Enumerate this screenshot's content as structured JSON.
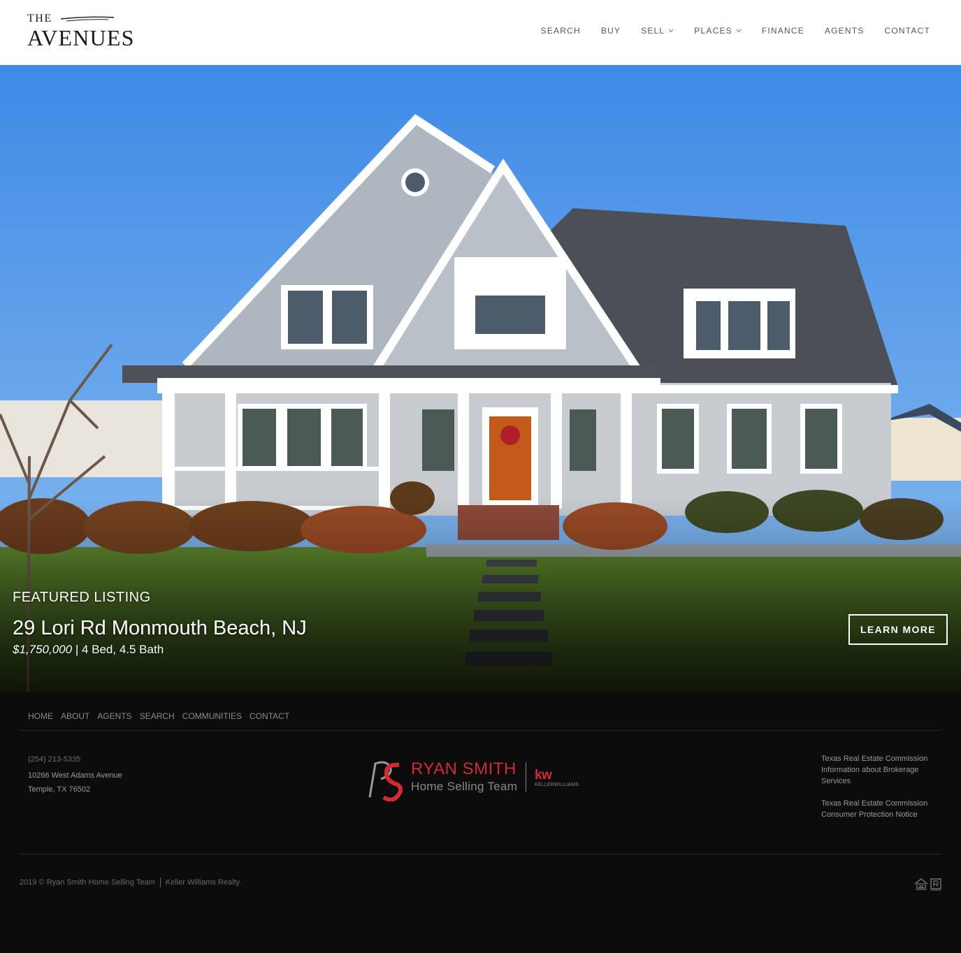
{
  "header": {
    "logo_top": "THE",
    "logo_main": "AVENUES",
    "nav": [
      {
        "label": "SEARCH",
        "dropdown": false
      },
      {
        "label": "BUY",
        "dropdown": false
      },
      {
        "label": "SELL",
        "dropdown": true
      },
      {
        "label": "PLACES",
        "dropdown": true
      },
      {
        "label": "FINANCE",
        "dropdown": false
      },
      {
        "label": "AGENTS",
        "dropdown": false
      },
      {
        "label": "CONTACT",
        "dropdown": false
      }
    ]
  },
  "hero": {
    "featured_label": "FEATURED LISTING",
    "address": "29 Lori Rd Monmouth Beach, NJ",
    "price": "$1,750,000",
    "details": " | 4 Bed, 4.5 Bath",
    "cta": "LEARN MORE"
  },
  "footer": {
    "nav": [
      "HOME",
      "ABOUT",
      "AGENTS",
      "SEARCH",
      "COMMUNITIES",
      "CONTACT"
    ],
    "phone": "(254) 213-5335",
    "address_line1": "10266 West Adams Avenue",
    "address_line2": "Temple, TX 76502",
    "team_name": "RYAN SMITH",
    "team_sub": "Home Selling Team",
    "kw": "kw",
    "kw_sub": "KELLERWILLIAMS.",
    "links": [
      "Texas Real Estate Commission Information about Brokerage Services",
      "Texas Real Estate Commission Consumer Protection Notice"
    ],
    "copyright": "2019 © Ryan Smith Home Selling Team",
    "brokerage": "Keller Williams Realty."
  },
  "colors": {
    "brand_red": "#d42a33",
    "footer_bg": "#0c0c0c",
    "sky": "#5a9be8",
    "nav_text": "#555555"
  },
  "icons": [
    "logo-swoosh-icon",
    "chevron-down-icon",
    "equal-housing-icon",
    "realtor-icon",
    "rs-monogram-icon"
  ]
}
